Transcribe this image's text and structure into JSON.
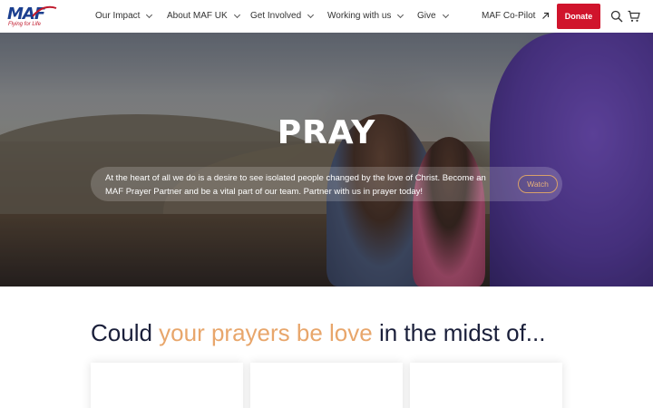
{
  "brand": {
    "logo_text": "MAF",
    "tagline": "Flying for Life",
    "accent_red": "#d0142c",
    "accent_orange": "#e8a66b",
    "navy": "#1a1f3a"
  },
  "nav": {
    "items": [
      {
        "label": "Our Impact",
        "icon": "chevron-down-icon"
      },
      {
        "label": "About MAF UK",
        "icon": "chevron-down-icon"
      },
      {
        "label": "Get Involved",
        "icon": "chevron-down-icon"
      },
      {
        "label": "Working with us",
        "icon": "chevron-down-icon"
      },
      {
        "label": "Give",
        "icon": "chevron-down-icon"
      }
    ],
    "external_link": {
      "label": "MAF Co-Pilot",
      "icon": "arrow-up-right-icon"
    },
    "donate_label": "Donate",
    "search_icon": "search-icon",
    "cart_icon": "cart-icon"
  },
  "hero": {
    "title": "PRAY",
    "text": "At the heart of all we do is a desire to see isolated people changed by the love of Christ. Become an MAF Prayer Partner and be a vital part of our team. Partner with us in prayer today!",
    "watch_label": "Watch"
  },
  "section": {
    "heading_start": "Could ",
    "heading_accent": "your prayers be love",
    "heading_end": " in the midst of..."
  }
}
